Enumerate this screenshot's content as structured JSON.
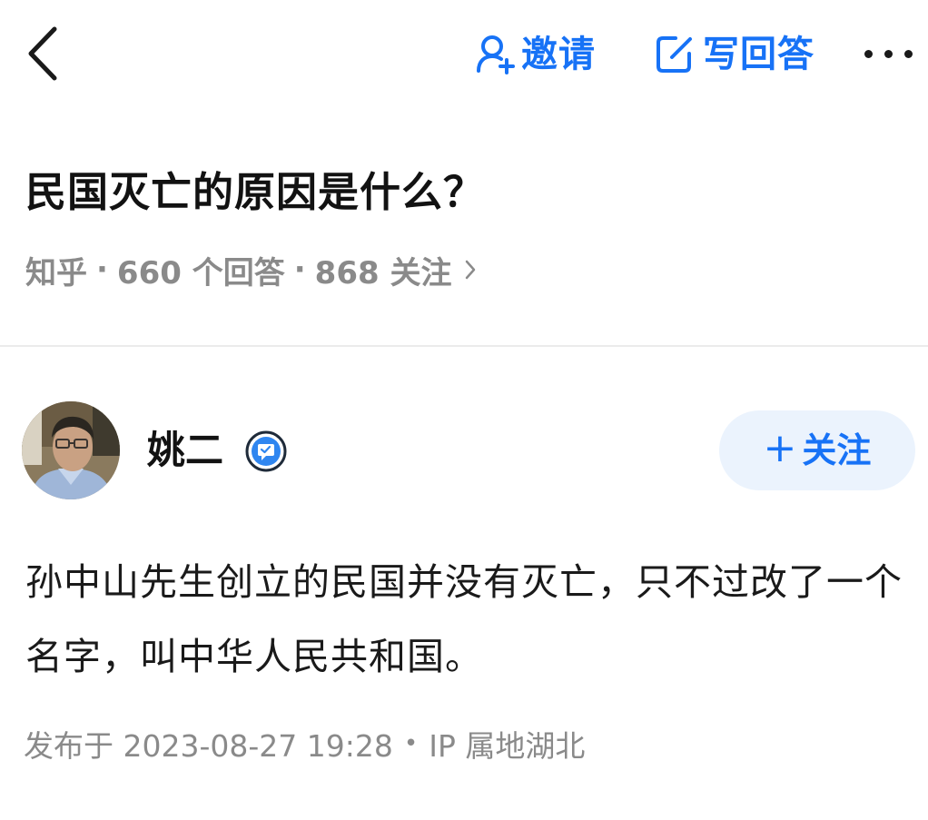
{
  "topbar": {
    "back_icon": "chevron-left-icon",
    "invite_icon": "person-add-icon",
    "invite_label": "邀请",
    "write_icon": "edit-square-icon",
    "write_label": "写回答",
    "more_icon": "more-horizontal-icon"
  },
  "question": {
    "title": "民国灭亡的原因是什么？",
    "source": "知乎",
    "sep1": "·",
    "answers_count": "660 个回答",
    "sep2": "·",
    "followers_count": "868 关注",
    "chevron_icon": "chevron-right-icon"
  },
  "author": {
    "name": "姚二",
    "verify_icon": "verified-badge-icon",
    "follow_label": "关注",
    "follow_plus": "+"
  },
  "answer": {
    "content": "孙中山先生创立的民国并没有灭亡，只不过改了一个名字，叫中华人民共和国。",
    "published": "发布于 2023-08-27 19:28",
    "meta_sep": "•",
    "ip_location": "IP 属地湖北"
  },
  "colors": {
    "accent": "#1772f6",
    "follow_bg": "#ebf3fd",
    "meta_gray": "#8a8a8a",
    "text": "#121212"
  }
}
